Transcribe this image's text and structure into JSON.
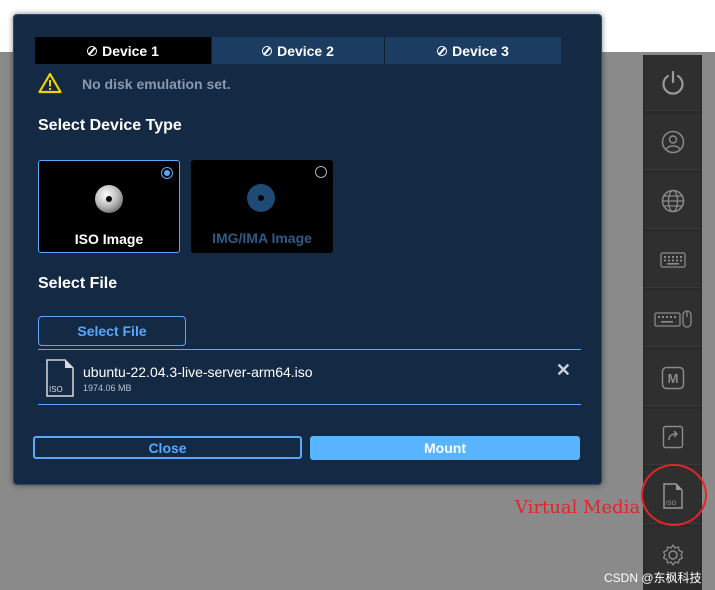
{
  "tabs": [
    {
      "label": "Device 1",
      "active": true
    },
    {
      "label": "Device 2",
      "active": false
    },
    {
      "label": "Device 3",
      "active": false
    }
  ],
  "status": {
    "message": "No disk emulation set.",
    "icon": "warning-triangle-icon"
  },
  "device_type": {
    "heading": "Select Device Type",
    "options": [
      {
        "label": "ISO Image",
        "selected": true
      },
      {
        "label": "IMG/IMA Image",
        "selected": false
      }
    ]
  },
  "file_section": {
    "heading": "Select File",
    "button_label": "Select File",
    "file": {
      "name": "ubuntu-22.04.3-live-server-arm64.iso",
      "size": "1974.06 MB",
      "icon_label": "ISO",
      "remove_glyph": "✕"
    }
  },
  "footer": {
    "close_label": "Close",
    "mount_label": "Mount"
  },
  "toolbar": {
    "items": [
      "power-icon",
      "user-icon",
      "globe-icon",
      "keyboard-icon",
      "keyboard-mouse-icon",
      "macro-icon",
      "share-icon",
      "iso-file-icon",
      "gear-icon"
    ],
    "iso_label": "ISO",
    "macro_label": "M"
  },
  "annotation": {
    "text": "Virtual Media"
  },
  "watermark": "CSDN @东枫科技",
  "colors": {
    "accent": "#58a8ff",
    "modal_bg": "#142944",
    "warning": "#f5d000",
    "annotation": "#e0252b"
  }
}
